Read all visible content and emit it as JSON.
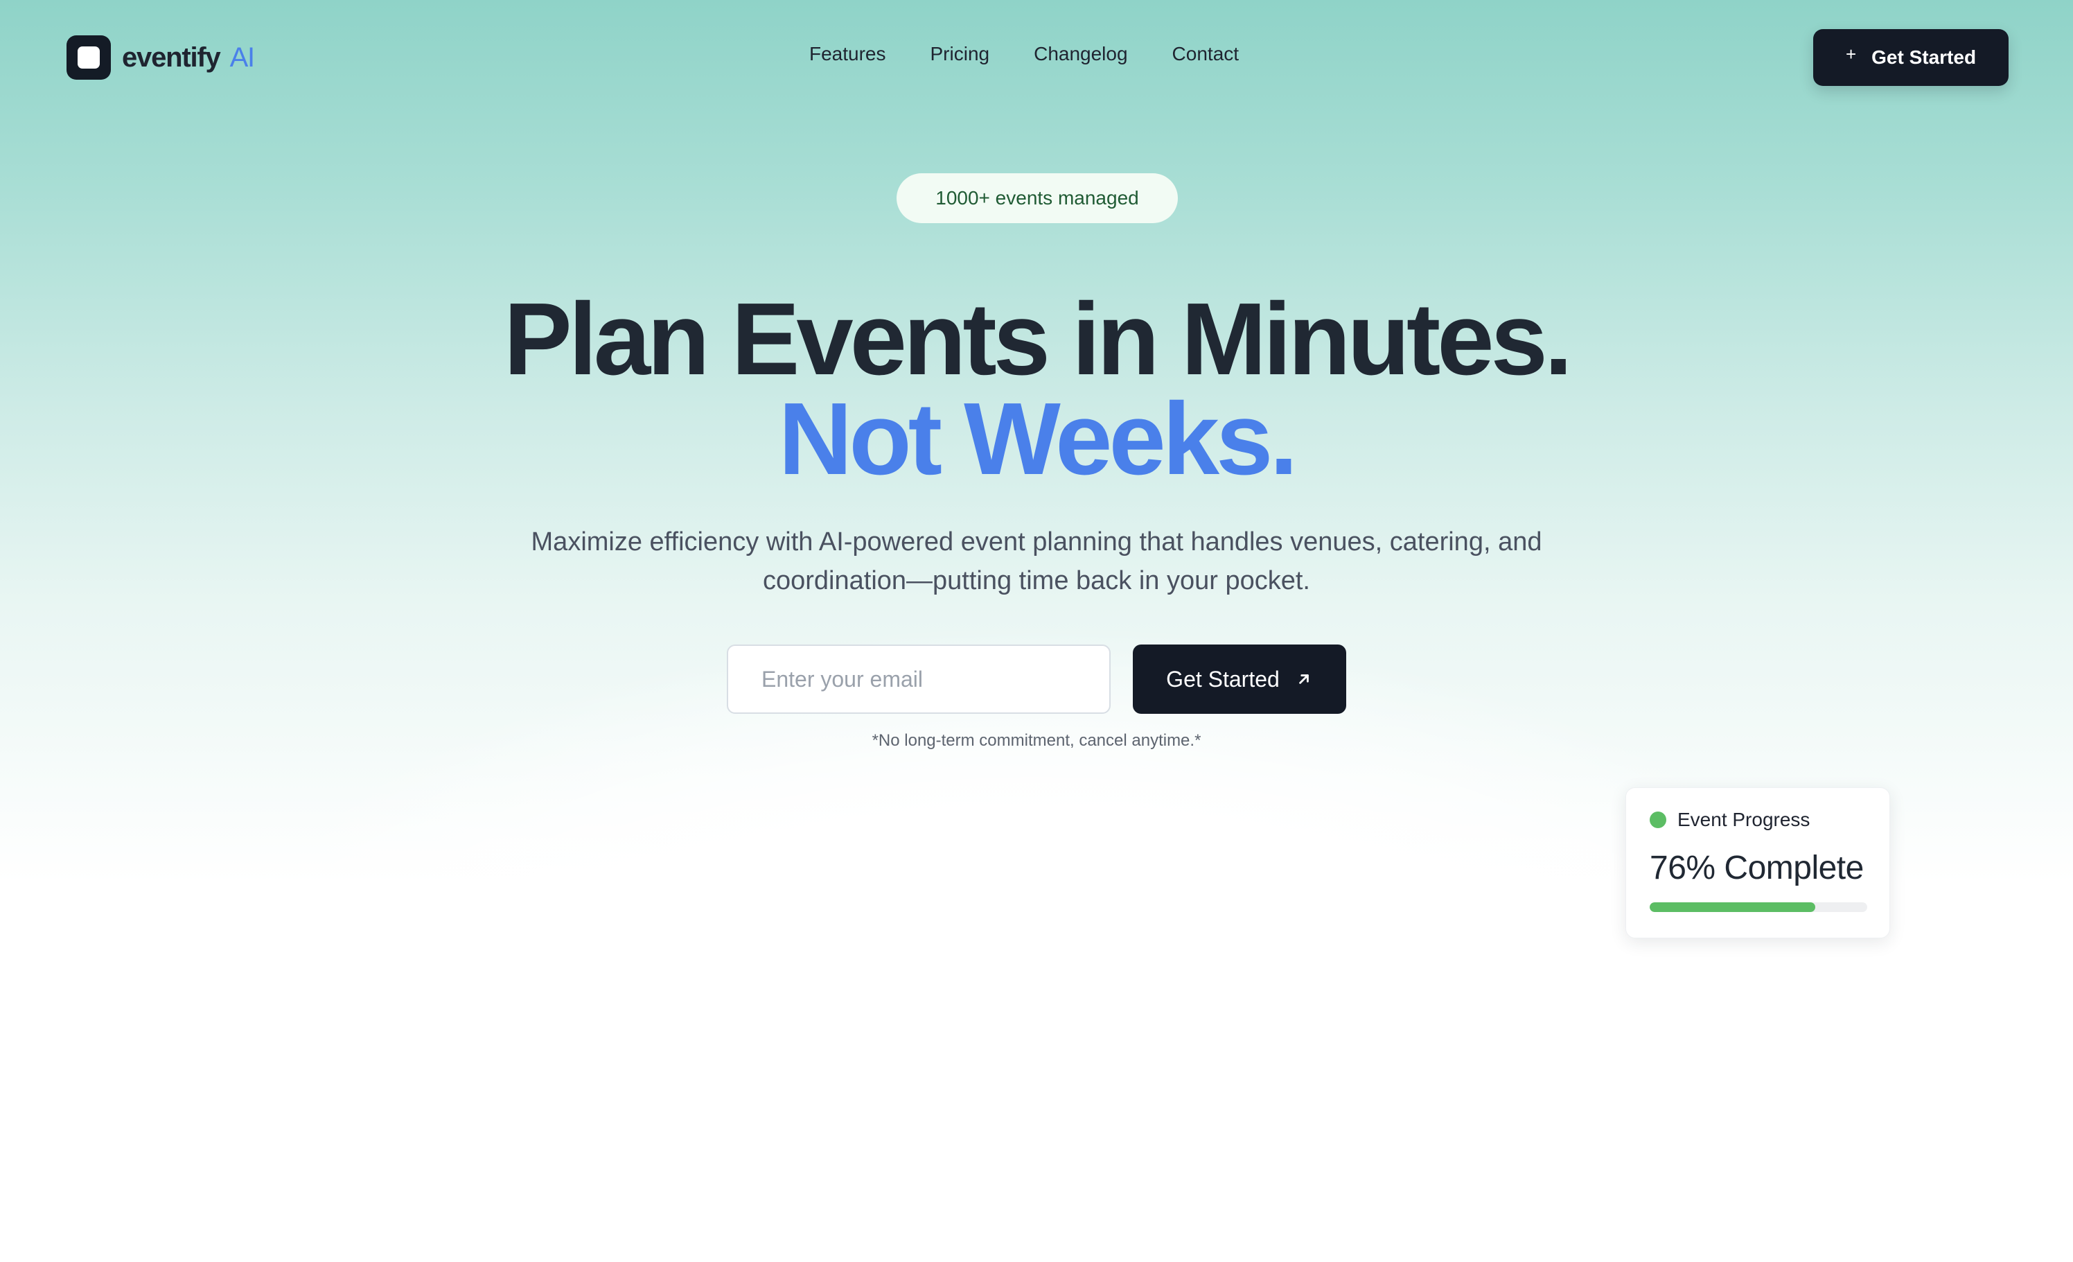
{
  "brand": {
    "name": "eventify",
    "suffix": "AI",
    "icon": "logo-icon",
    "accent_color": "#4a80ea"
  },
  "nav": {
    "links": [
      "Features",
      "Pricing",
      "Changelog",
      "Contact"
    ],
    "cta_label": "Get Started",
    "cta_icon": "plus-icon"
  },
  "hero": {
    "badge": "1000+ events managed",
    "headline_line1": "Plan Events in Minutes.",
    "headline_line2": "Not Weeks.",
    "subtitle": "Maximize efficiency with AI-powered event planning that handles venues, catering, and coordination—putting time back in your pocket.",
    "email_placeholder": "Enter your email",
    "cta_label": "Get Started",
    "cta_icon": "arrow-up-right-icon",
    "disclaimer": "*No long-term commitment, cancel anytime.*"
  },
  "progress_card": {
    "title": "Event Progress",
    "value_text": "76% Complete",
    "progress": 0.76,
    "status_color": "#5cbd64"
  }
}
